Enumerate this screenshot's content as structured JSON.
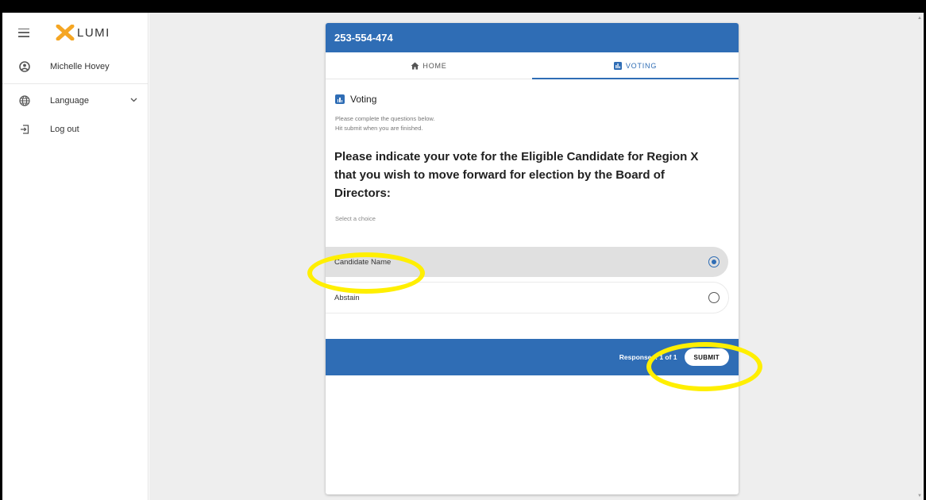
{
  "brand": {
    "name": "LUMI",
    "mark_color": "#f5a623"
  },
  "sidebar": {
    "items": [
      {
        "label": "Michelle Hovey",
        "icon": "account-circle-icon"
      },
      {
        "label": "Language",
        "icon": "globe-icon",
        "has_dropdown": true
      },
      {
        "label": "Log out",
        "icon": "logout-icon"
      }
    ]
  },
  "card": {
    "header": "253-554-474",
    "tabs": [
      {
        "label": "HOME",
        "icon": "home-icon",
        "active": false
      },
      {
        "label": "VOTING",
        "icon": "bar-chart-icon",
        "active": true
      }
    ],
    "section_title": "Voting",
    "instructions": [
      "Please complete the questions below.",
      "Hit submit when you are finished."
    ],
    "question": "Please indicate your vote for the Eligible Candidate for Region X that you wish to move forward for election by the Board of Directors:",
    "select_hint": "Select a choice",
    "options": [
      {
        "label": "Candidate Name",
        "selected": true
      },
      {
        "label": "Abstain",
        "selected": false
      }
    ],
    "footer": {
      "responses": "Responses: 1 of 1",
      "submit_label": "SUBMIT"
    }
  },
  "colors": {
    "primary": "#2f6db5",
    "highlight": "#ffef00",
    "background": "#eeeeee"
  }
}
